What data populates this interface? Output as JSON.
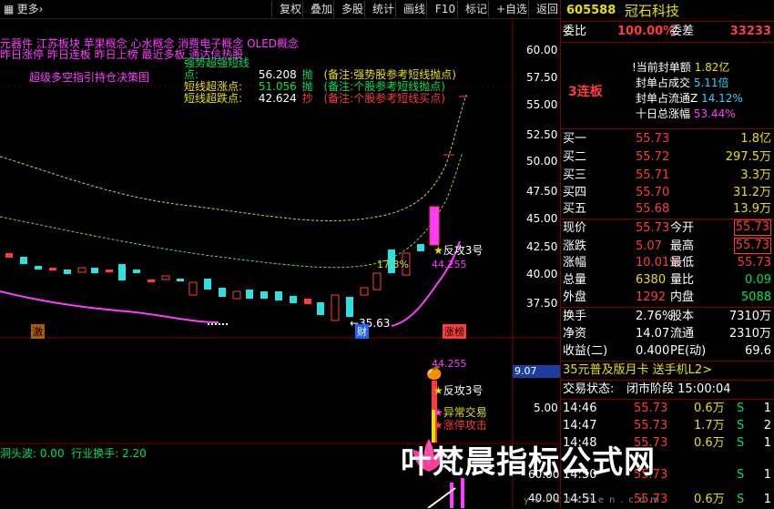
{
  "toolbar": {
    "left_icon": "grid-icon",
    "more_label": "更多",
    "more_arrow": "›",
    "buttons": [
      "复权",
      "叠加",
      "多股",
      "统计",
      "画线",
      "F10",
      "标记",
      "+自选",
      "返回"
    ]
  },
  "chart": {
    "concept_tags": "元器件  江苏板块  苹果概念  心水概念  消费电子概念  OLED概念",
    "tag_line2": "昨日涨停  昨日连板  昨日上榜  最近多板  通达信热股",
    "strategy_label": "超级多空指引持仓决策图",
    "indicator_rows": [
      {
        "name": "强势超强短线点:",
        "value": "56.208",
        "flag": "抛",
        "note": "(备注:强势股参考短线抛点)"
      },
      {
        "name": "短线超涨点:",
        "value": "51.056",
        "flag": "抛",
        "note": "(备注:个股参考短线抛点)"
      },
      {
        "name": "短线超跌点:",
        "value": "42.624",
        "flag": "抄",
        "note": "(备注:个股参考短线买点)"
      }
    ],
    "y_axis_ticks": [
      "60.00",
      "57.50",
      "55.00",
      "52.50",
      "50.00",
      "47.50",
      "45.00",
      "42.50",
      "40.00",
      "37.50"
    ],
    "markers": {
      "low_price": "35.63",
      "pct_label": "17.3%",
      "fangong1": "反攻3号",
      "price_44": "44.255",
      "event_ji": "激",
      "event_cai": "财",
      "event_zhangbang": "涨榜"
    },
    "sub_panel": {
      "value_44": "44.255",
      "fangong2": "反攻3号",
      "abnormal": "异常交易",
      "limit_attack": "涨停攻击",
      "left_value": "9.07",
      "tick_500": "5.00",
      "tick_6000": "60.00",
      "tick_4000": "40.00",
      "bottom_text": "洞头波: 0.00  行业换手: 2.20"
    }
  },
  "quote": {
    "code": "605588",
    "name": "冠石科技",
    "weibi_label": "委比",
    "weibi_value": "100.00%",
    "weicha_label": "委差",
    "weicha_value": "33233",
    "limit_info": {
      "tag": "3连板",
      "lines": [
        {
          "label": "!当前封单额",
          "value": "1.82亿"
        },
        {
          "label": "封单占成交",
          "value": "5.11倍"
        },
        {
          "label": "封单占流通Z",
          "value": "14.12%"
        },
        {
          "label": "十日总涨幅",
          "value": "53.44%"
        }
      ]
    },
    "bids": [
      {
        "label": "买一",
        "price": "55.73",
        "vol": "1.8亿"
      },
      {
        "label": "买二",
        "price": "55.72",
        "vol": "297.5万"
      },
      {
        "label": "买三",
        "price": "55.71",
        "vol": "3.3万"
      },
      {
        "label": "买四",
        "price": "55.70",
        "vol": "31.2万"
      },
      {
        "label": "买五",
        "price": "55.68",
        "vol": "13.9万"
      }
    ],
    "stats": [
      {
        "l1": "现价",
        "v1": "55.73",
        "l2": "今开",
        "v2": "55.73"
      },
      {
        "l1": "涨跌",
        "v1": "5.07",
        "l2": "最高",
        "v2": "55.73"
      },
      {
        "l1": "涨幅",
        "v1": "10.01%",
        "l2": "最低",
        "v2": "55.73"
      },
      {
        "l1": "总量",
        "v1": "6380",
        "l2": "量比",
        "v2": "0.09"
      },
      {
        "l1": "外盘",
        "v1": "1292",
        "l2": "内盘",
        "v2": "5088"
      }
    ],
    "stats2": [
      {
        "l1": "换手",
        "v1": "2.76%",
        "l2": "股本",
        "v2": "7310万"
      },
      {
        "l1": "净资",
        "v1": "14.07",
        "l2": "流通",
        "v2": "2310万"
      },
      {
        "l1": "收益(二)",
        "v1": "0.400",
        "l2": "PE(动)",
        "v2": "69.6"
      }
    ],
    "promo": "35元普及版月卡 送手机L2>",
    "trade_status_label": "交易状态:",
    "trade_status_value": "闭市阶段 15:00:04",
    "ticks": [
      {
        "time": "14:46",
        "price": "55.73",
        "vol": "0.6万",
        "side": "S",
        "n": "1"
      },
      {
        "time": "14:47",
        "price": "55.73",
        "vol": "1.7万",
        "side": "S",
        "n": "2"
      },
      {
        "time": "14:48",
        "price": "55.73",
        "vol": "0.6万",
        "side": "S",
        "n": "1"
      },
      {
        "time": "14:50",
        "price": "55.73",
        "vol": "",
        "side": "S",
        "n": "1"
      },
      {
        "time": "14:51",
        "price": "55.73",
        "vol": "0.6万",
        "side": "S",
        "n": "1"
      }
    ]
  },
  "watermark": {
    "text": "叶梵晨指标公式网",
    "url": "yefanchen.com"
  },
  "colors": {
    "up": "#ff3b3b",
    "down": "#30e0e0",
    "ma_magenta": "#ff3cff",
    "panel_border": "#800000"
  }
}
